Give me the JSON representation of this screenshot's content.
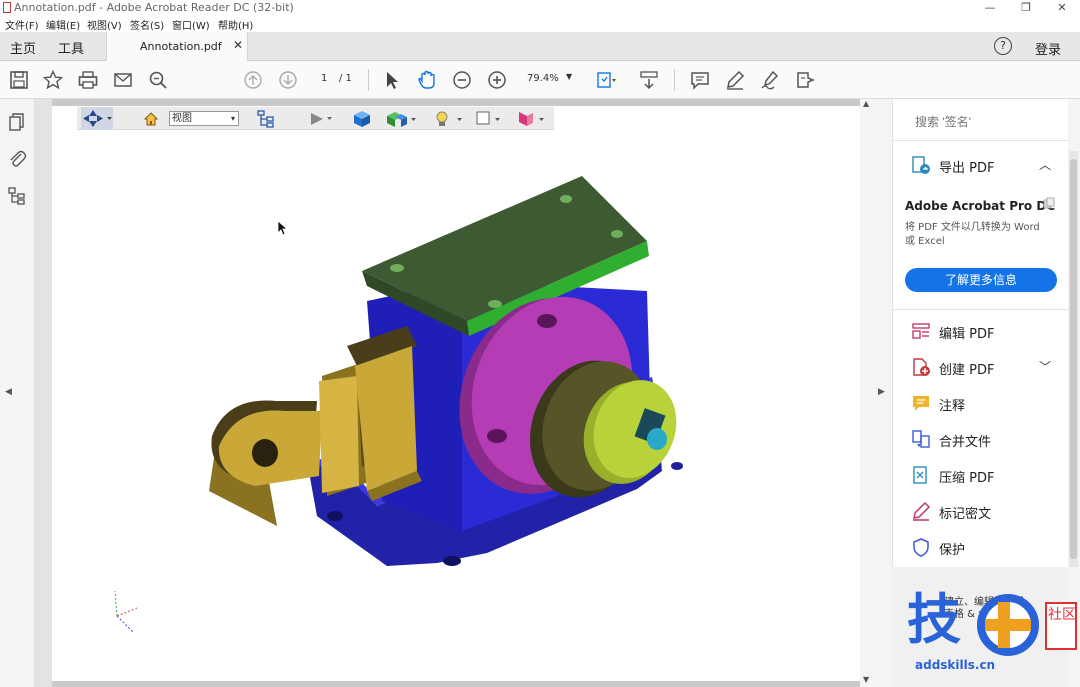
{
  "window": {
    "title": "Annotation.pdf - Adobe Acrobat Reader DC (32-bit)",
    "minimize": "—",
    "restore": "❐",
    "close": "✕"
  },
  "menu": {
    "items": [
      "文件(F)",
      "编辑(E)",
      "视图(V)",
      "签名(S)",
      "窗口(W)",
      "帮助(H)"
    ]
  },
  "tabs": {
    "home": "主页",
    "tools": "工具",
    "document": "Annotation.pdf",
    "document_close": "✕",
    "signin": "登录",
    "help": "?"
  },
  "toolbar": {
    "page_current": "1",
    "page_total": "/ 1",
    "zoom": "79.4%"
  },
  "view3d": {
    "view_select_value": "视图"
  },
  "right_panel": {
    "search_placeholder": "搜索 '签名'",
    "export_pdf": "导出 PDF",
    "promo_title": "Adobe Acrobat Pro DC",
    "promo_desc": "将 PDF 文件以几转换为 Word 或 Excel",
    "learn_more": "了解更多信息",
    "tools": [
      {
        "label": "编辑 PDF",
        "icon": "edit-pdf-icon"
      },
      {
        "label": "创建 PDF",
        "icon": "create-pdf-icon"
      },
      {
        "label": "注释",
        "icon": "comment-icon"
      },
      {
        "label": "合并文件",
        "icon": "combine-files-icon"
      },
      {
        "label": "压缩 PDF",
        "icon": "compress-pdf-icon"
      },
      {
        "label": "标记密文",
        "icon": "redact-icon"
      },
      {
        "label": "保护",
        "icon": "protect-icon"
      }
    ],
    "bottom_text_1": "建立、编辑和签署",
    "bottom_text_2": "表格 & 合约"
  },
  "watermark": {
    "glyph": "技",
    "side": "社区",
    "url": "addskills.cn"
  },
  "colors": {
    "accent_blue": "#1473e6",
    "model_blue": "#2b2bd6",
    "model_green": "#3d5a32",
    "model_yellow": "#c9a838",
    "model_magenta": "#b43cb4",
    "model_lime": "#b8d23a"
  }
}
